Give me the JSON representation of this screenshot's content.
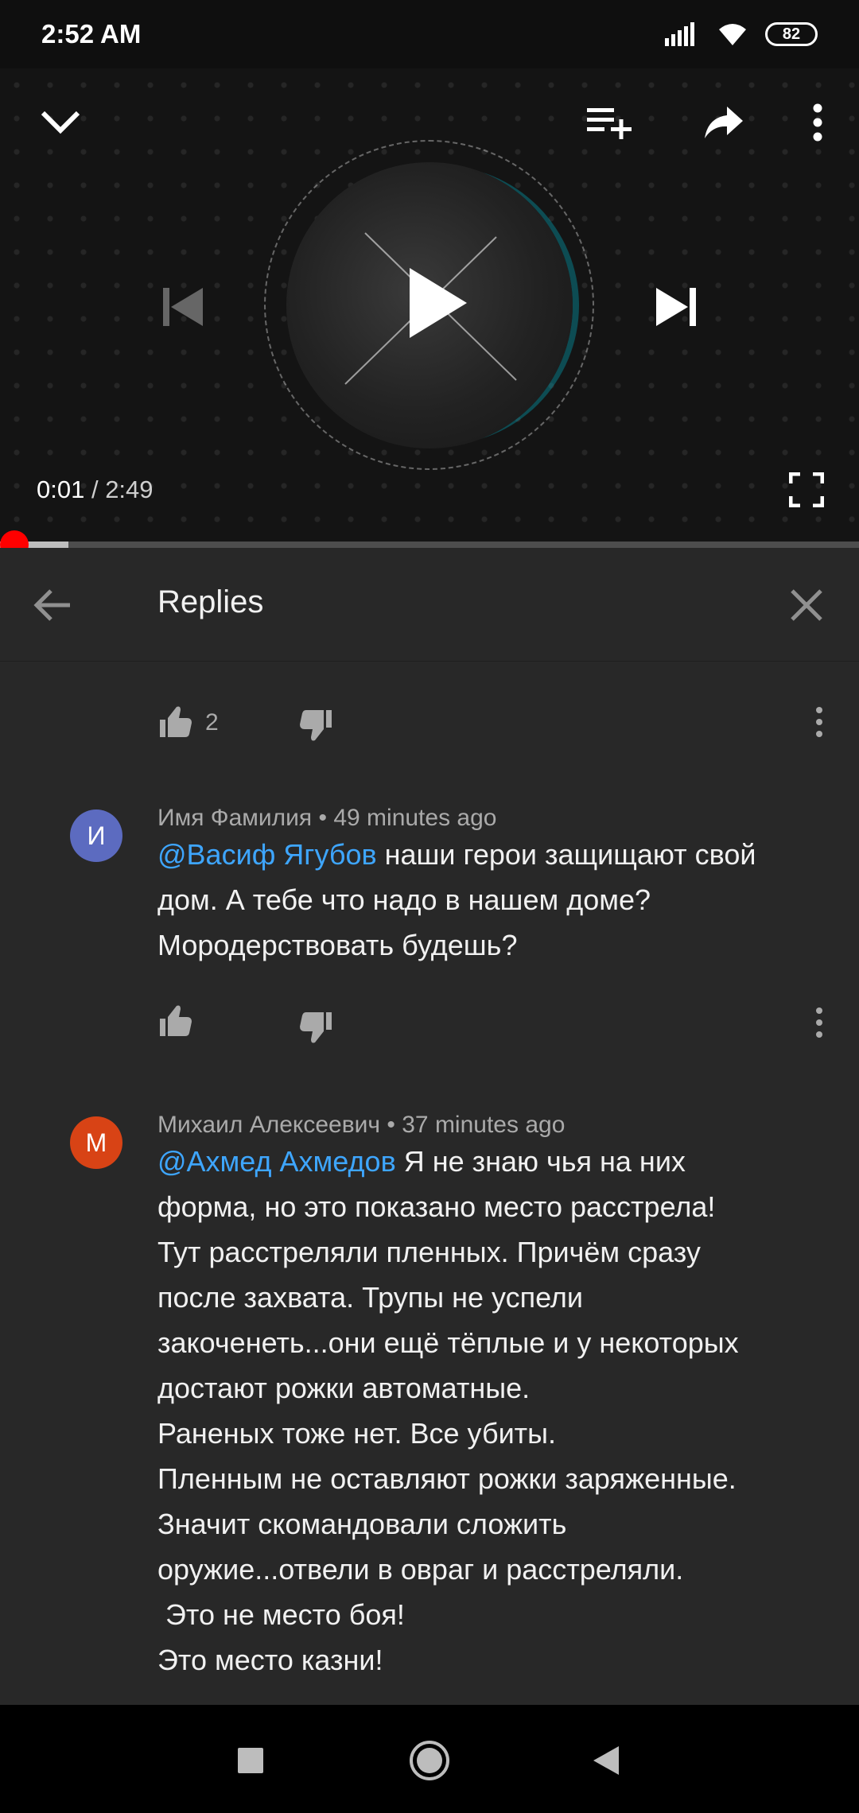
{
  "status_bar": {
    "time": "2:52 AM",
    "battery": "82"
  },
  "player": {
    "current_time": "0:01",
    "separator": " / ",
    "duration": "2:49",
    "progress_fraction": 0.006,
    "buffered_fraction": 0.08
  },
  "replies_header": {
    "title": "Replies"
  },
  "top_comment_actions": {
    "like_count": "2"
  },
  "comments": [
    {
      "avatar_letter": "И",
      "avatar_color": "#5c6bc0",
      "author": "Имя Фамилия",
      "time": " • 49 minutes ago",
      "mention": "@Васиф Ягубов",
      "text": " наши герои защищают свой\nдом. А тебе что надо в нашем доме?\nМородерствовать будешь?"
    },
    {
      "avatar_letter": "М",
      "avatar_color": "#d84315",
      "author": "Михаил Алексеевич",
      "time": " • 37 minutes ago",
      "mention": "@Ахмед Ахмедов",
      "text": " Я не знаю чья на них\nформа, но это показано место расстрела!\nТут расстреляли пленных. Причём сразу\nпосле захвата. Трупы не успели\nзакоченеть...они ещё тёплые и у некоторых\nдостают рожки автоматные.\nРаненых тоже нет. Все убиты.\nПленным не оставляют рожки заряженные.\nЗначит скомандовали сложить\nоружие...отвели в овраг и расстреляли.\n Это не место боя!\nЭто место казни!"
    }
  ],
  "icons": {
    "collapse": "chevron-down-icon",
    "queue": "add-to-queue-icon",
    "share": "share-icon",
    "more": "more-vert-icon",
    "previous": "skip-previous-icon",
    "play": "play-icon",
    "next": "skip-next-icon",
    "fullscreen": "fullscreen-icon",
    "back": "arrow-back-icon",
    "close": "close-icon",
    "like": "thumb-up-icon",
    "dislike": "thumb-down-icon"
  },
  "colors": {
    "accent_red": "#ff0000",
    "mention_blue": "#3ea6ff",
    "background": "#282828"
  }
}
